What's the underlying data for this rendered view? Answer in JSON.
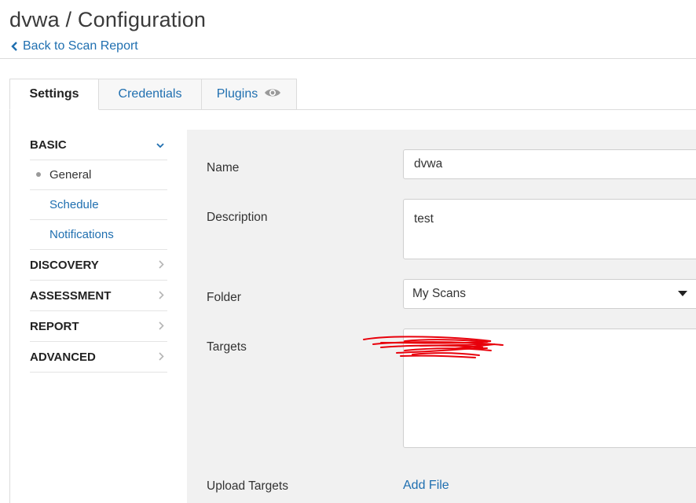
{
  "header": {
    "title": "dvwa / Configuration",
    "back_link": "Back to Scan Report"
  },
  "tabs": [
    {
      "label": "Settings",
      "active": true
    },
    {
      "label": "Credentials",
      "active": false
    },
    {
      "label": "Plugins",
      "active": false,
      "icon": "eye-icon"
    }
  ],
  "sidenav": {
    "sections": [
      {
        "label": "BASIC",
        "expanded": true,
        "icon": "chevron-down-icon"
      },
      {
        "label": "DISCOVERY",
        "expanded": false,
        "icon": "chevron-right-icon"
      },
      {
        "label": "ASSESSMENT",
        "expanded": false,
        "icon": "chevron-right-icon"
      },
      {
        "label": "REPORT",
        "expanded": false,
        "icon": "chevron-right-icon"
      },
      {
        "label": "ADVANCED",
        "expanded": false,
        "icon": "chevron-right-icon"
      }
    ],
    "basic_items": [
      {
        "label": "General",
        "current": true
      },
      {
        "label": "Schedule",
        "current": false
      },
      {
        "label": "Notifications",
        "current": false
      }
    ]
  },
  "form": {
    "name": {
      "label": "Name",
      "value": "dvwa"
    },
    "description": {
      "label": "Description",
      "value": "test"
    },
    "folder": {
      "label": "Folder",
      "value": "My Scans"
    },
    "targets": {
      "label": "Targets",
      "value": ""
    },
    "upload_targets": {
      "label": "Upload Targets",
      "link": "Add File"
    }
  },
  "colors": {
    "link": "#1f6fb0",
    "panel_bg": "#f1f1f1",
    "redaction": "#e8000b"
  }
}
